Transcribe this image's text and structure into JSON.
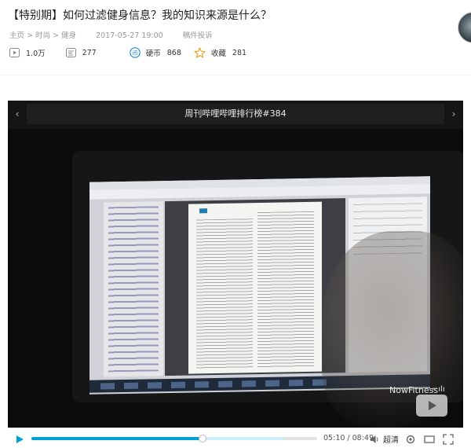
{
  "header": {
    "title": "【特别期】如何过滤健身信息？我的知识来源是什么？",
    "breadcrumb": [
      "主页",
      "时尚",
      "健身"
    ],
    "breadcrumb_sep": " > ",
    "date": "2017-05-27 19:00",
    "report_label": "稿件投诉"
  },
  "stats": {
    "plays": "1.0万",
    "danmaku": "277",
    "coins_label": "硬币",
    "coins": "868",
    "favorites_label": "收藏",
    "favorites": "281"
  },
  "player": {
    "rank_title": "周刊哔哩哔哩排行榜#384",
    "brand": "NowFitness",
    "brand_mark": "⌐ılı",
    "progress": 0.6,
    "buffered": 0.885,
    "time_current": "05:10",
    "time_sep": " / ",
    "time_total": "08:49",
    "quality_label": "超清"
  },
  "colors": {
    "accent": "#00a1d6",
    "coin_blue": "#1e88d8",
    "star_orange": "#f0a326"
  },
  "icons": {
    "plays": "play-count-icon",
    "danmaku": "danmaku-icon",
    "coin": "coin-icon",
    "favorite": "star-icon",
    "prev": "chevron-left-icon",
    "next": "chevron-right-icon"
  }
}
